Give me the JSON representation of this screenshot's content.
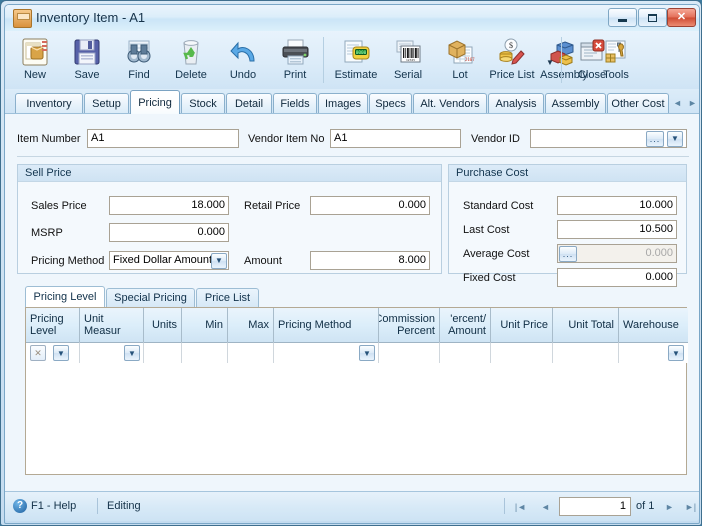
{
  "window": {
    "title": "Inventory Item - A1",
    "icon": "inventory-box-icon",
    "controls": {
      "minimize": "–",
      "maximize": "□",
      "close": "✕"
    }
  },
  "toolbar": {
    "buttons": [
      {
        "label": "New",
        "icon": "new-document-icon"
      },
      {
        "label": "Save",
        "icon": "floppy-disk-icon"
      },
      {
        "label": "Find",
        "icon": "binoculars-icon"
      },
      {
        "label": "Delete",
        "icon": "recycle-bin-icon"
      },
      {
        "label": "Undo",
        "icon": "undo-arrow-icon"
      },
      {
        "label": "Print",
        "icon": "printer-icon"
      },
      {
        "label": "Estimate",
        "icon": "estimate-calculator-icon"
      },
      {
        "label": "Serial",
        "icon": "barcode-icon"
      },
      {
        "label": "Lot",
        "icon": "lot-box-icon"
      },
      {
        "label": "Price List",
        "icon": "price-tag-icon"
      },
      {
        "label": "Assembly",
        "icon": "assembly-blocks-icon"
      },
      {
        "label": "Tools",
        "icon": "tools-wrench-icon"
      },
      {
        "label": "Close",
        "icon": "close-window-icon"
      }
    ],
    "tools_dropdown": "▼"
  },
  "tabs": {
    "items": [
      "Inventory",
      "Setup",
      "Pricing",
      "Stock",
      "Detail",
      "Fields",
      "Images",
      "Specs",
      "Alt. Vendors",
      "Analysis",
      "Assembly",
      "Other Cost"
    ],
    "active": "Pricing",
    "scroll_left": "◄",
    "scroll_right": "►"
  },
  "header_fields": {
    "item_number": {
      "label": "Item Number",
      "value": "A1"
    },
    "vendor_item_no": {
      "label": "Vendor Item No",
      "value": "A1"
    },
    "vendor_id": {
      "label": "Vendor ID",
      "value": "",
      "ellipsis": "...",
      "dropdown": "▼"
    }
  },
  "sell_price": {
    "title": "Sell Price",
    "sales_price": {
      "label": "Sales Price",
      "value": "18.000"
    },
    "retail_price": {
      "label": "Retail Price",
      "value": "0.000"
    },
    "msrp": {
      "label": "MSRP",
      "value": "0.000"
    },
    "pricing_method": {
      "label": "Pricing Method",
      "value": "Fixed Dollar Amount",
      "dropdown": "▼"
    },
    "amount": {
      "label": "Amount",
      "value": "8.000"
    }
  },
  "purchase_cost": {
    "title": "Purchase Cost",
    "standard_cost": {
      "label": "Standard Cost",
      "value": "10.000"
    },
    "last_cost": {
      "label": "Last Cost",
      "value": "10.500"
    },
    "average_cost": {
      "label": "Average Cost",
      "value": "0.000",
      "ellipsis": "..."
    },
    "fixed_cost": {
      "label": "Fixed Cost",
      "value": "0.000"
    }
  },
  "inner_tabs": {
    "items": [
      "Pricing Level",
      "Special Pricing",
      "Price List"
    ],
    "active": "Pricing Level"
  },
  "grid": {
    "columns": [
      {
        "label": "Pricing Level",
        "align": "left"
      },
      {
        "label": "Unit Measur",
        "align": "right"
      },
      {
        "label": "Units",
        "align": "right"
      },
      {
        "label": "Min",
        "align": "right"
      },
      {
        "label": "Max",
        "align": "right"
      },
      {
        "label": "Pricing Method",
        "align": "left"
      },
      {
        "label": "Commission Percent",
        "align": "right"
      },
      {
        "label": "'ercent/ Amount",
        "align": "right"
      },
      {
        "label": "Unit Price",
        "align": "right"
      },
      {
        "label": "Unit Total",
        "align": "right"
      },
      {
        "label": "Warehouse",
        "align": "left"
      }
    ],
    "row": {
      "delete_glyph": "✕",
      "dropdown_glyph": "▼"
    }
  },
  "statusbar": {
    "help": "F1 - Help",
    "mode": "Editing",
    "first": "|◄",
    "prev": "◄",
    "record": "1",
    "of_label": "of 1",
    "next": "►",
    "last": "►|"
  }
}
